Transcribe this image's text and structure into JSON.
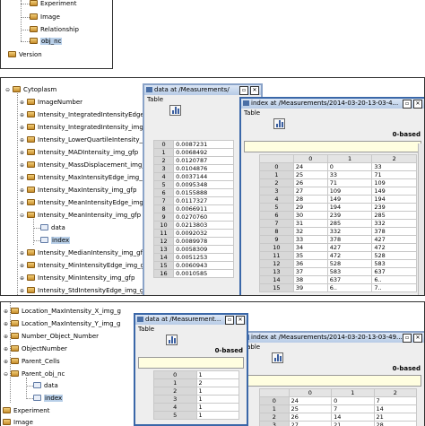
{
  "panel1": {
    "nodes": [
      {
        "label": "Experiment"
      },
      {
        "label": "Image"
      },
      {
        "label": "Relationship"
      },
      {
        "label": "obj_nc"
      },
      {
        "label": "Version"
      }
    ]
  },
  "panel2": {
    "nodes": [
      {
        "label": "Cytoplasm"
      },
      {
        "label": "ImageNumber"
      },
      {
        "label": "Intensity_IntegratedIntensityEdge_img_"
      },
      {
        "label": "Intensity_IntegratedIntensity_img_gfp"
      },
      {
        "label": "Intensity_LowerQuartileIntensity_img_gfp"
      },
      {
        "label": "Intensity_MADIntensity_img_gfp"
      },
      {
        "label": "Intensity_MassDisplacement_img_gfp"
      },
      {
        "label": "Intensity_MaxIntensityEdge_img_gfp"
      },
      {
        "label": "Intensity_MaxIntensity_img_gfp"
      },
      {
        "label": "Intensity_MeanIntensityEdge_img_gfp"
      },
      {
        "label": "Intensity_MeanIntensity_img_gfp"
      },
      {
        "label": "data"
      },
      {
        "label": "index"
      },
      {
        "label": "Intensity_MedianIntensity_img_gfp"
      },
      {
        "label": "Intensity_MinIntensityEdge_img_gfp"
      },
      {
        "label": "Intensity_MinIntensity_img_gfp"
      },
      {
        "label": "Intensity_StdIntensityEdge_img_gfp"
      }
    ],
    "data_window": {
      "title": "data  at  /Measurements/",
      "menu": "Table",
      "rows": [
        [
          "0",
          "0.0087231"
        ],
        [
          "1",
          "0.0068492"
        ],
        [
          "2",
          "0.0120787"
        ],
        [
          "3",
          "0.0104876"
        ],
        [
          "4",
          "0.0037144"
        ],
        [
          "5",
          "0.0095348"
        ],
        [
          "6",
          "0.0155888"
        ],
        [
          "7",
          "0.0117327"
        ],
        [
          "8",
          "0.0066911"
        ],
        [
          "9",
          "0.0270760"
        ],
        [
          "10",
          "0.0213803"
        ],
        [
          "11",
          "0.0092032"
        ],
        [
          "12",
          "0.0089978"
        ],
        [
          "13",
          "0.0058309"
        ],
        [
          "14",
          "0.0051253"
        ],
        [
          "15",
          "0.0060943"
        ],
        [
          "16",
          "0.0010585"
        ]
      ]
    },
    "index_window": {
      "title": "index  at  /Measurements/2014-03-20-13-03-4...",
      "menu": "Table",
      "based": "0-based",
      "columns": [
        "",
        "0",
        "1",
        "2"
      ],
      "rows": [
        [
          "0",
          "24",
          "0",
          "33"
        ],
        [
          "1",
          "25",
          "33",
          "71"
        ],
        [
          "2",
          "26",
          "71",
          "109"
        ],
        [
          "3",
          "27",
          "109",
          "149"
        ],
        [
          "4",
          "28",
          "149",
          "194"
        ],
        [
          "5",
          "29",
          "194",
          "239"
        ],
        [
          "6",
          "30",
          "239",
          "285"
        ],
        [
          "7",
          "31",
          "285",
          "332"
        ],
        [
          "8",
          "32",
          "332",
          "378"
        ],
        [
          "9",
          "33",
          "378",
          "427"
        ],
        [
          "10",
          "34",
          "427",
          "472"
        ],
        [
          "11",
          "35",
          "472",
          "528"
        ],
        [
          "12",
          "36",
          "528",
          "583"
        ],
        [
          "13",
          "37",
          "583",
          "637"
        ],
        [
          "14",
          "38",
          "637",
          "6.."
        ],
        [
          "15",
          "39",
          "6..",
          "7.."
        ]
      ]
    }
  },
  "panel3": {
    "nodes": [
      {
        "label": "Location_MaxIntensity_X_img_g"
      },
      {
        "label": "Location_MaxIntensity_Y_img_g"
      },
      {
        "label": "Number_Object_Number"
      },
      {
        "label": "ObjectNumber"
      },
      {
        "label": "Parent_Cells"
      },
      {
        "label": "Parent_obj_nc"
      },
      {
        "label": "data"
      },
      {
        "label": "index"
      },
      {
        "label": "Experiment"
      },
      {
        "label": "Image"
      }
    ],
    "data_window": {
      "title": "data  at  /Measurement...",
      "menu": "Table",
      "based": "0-based",
      "rows": [
        [
          "0",
          "1"
        ],
        [
          "1",
          "2"
        ],
        [
          "2",
          "1"
        ],
        [
          "3",
          "1"
        ],
        [
          "4",
          "1"
        ],
        [
          "5",
          "1"
        ]
      ]
    },
    "index_window": {
      "title": "index  at  /Measurements/2014-03-20-13-03-49...",
      "menu": "Table",
      "based": "0-based",
      "columns": [
        "",
        "0",
        "1",
        "2"
      ],
      "rows": [
        [
          "0",
          "24",
          "0",
          "7"
        ],
        [
          "1",
          "25",
          "7",
          "14"
        ],
        [
          "2",
          "26",
          "14",
          "21"
        ],
        [
          "3",
          "27",
          "21",
          "28"
        ],
        [
          "4",
          "28",
          "28",
          "35"
        ]
      ]
    }
  }
}
